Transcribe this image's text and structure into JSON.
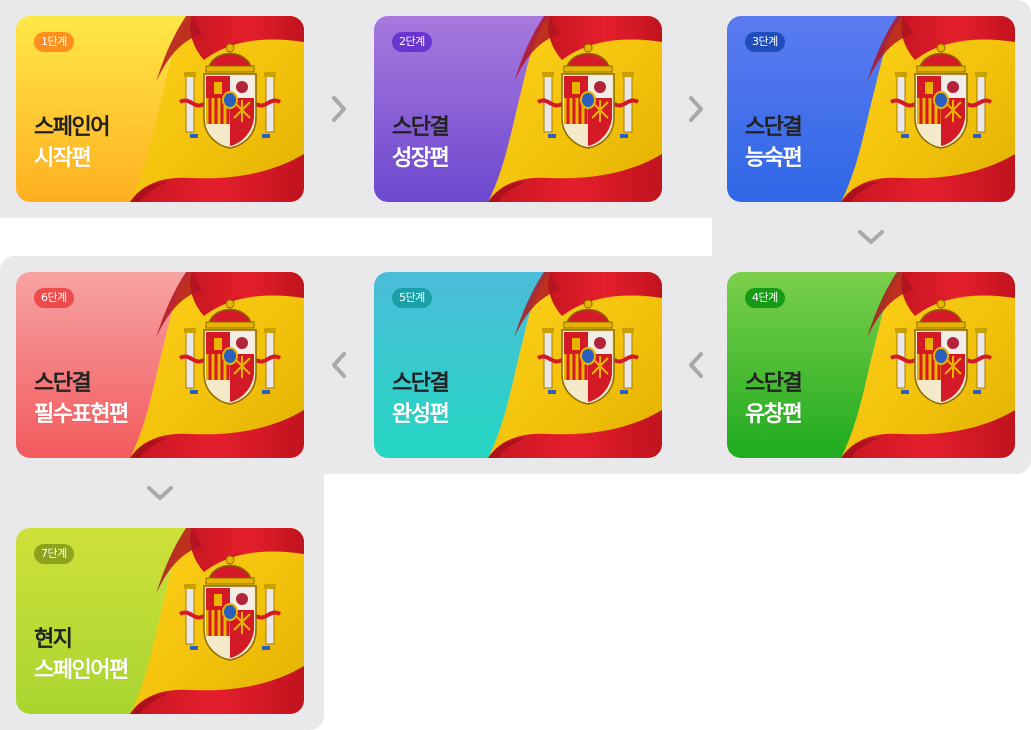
{
  "stages": [
    {
      "badge": "1단계",
      "line1": "스페인어",
      "line2": "시작편",
      "color_top": "#ffe748",
      "color_bottom": "#ffb020",
      "badge_color": "#ff8f1f"
    },
    {
      "badge": "2단계",
      "line1": "스단결",
      "line2": "성장편",
      "color_top": "#a879dd",
      "color_bottom": "#6d48cf",
      "badge_color": "#6a35cf"
    },
    {
      "badge": "3단계",
      "line1": "스단결",
      "line2": "능숙편",
      "color_top": "#5b7bf0",
      "color_bottom": "#2f67e6",
      "badge_color": "#1f4dbb"
    },
    {
      "badge": "4단계",
      "line1": "스단결",
      "line2": "유창편",
      "color_top": "#7cd04c",
      "color_bottom": "#1fab1f",
      "badge_color": "#159b15"
    },
    {
      "badge": "5단계",
      "line1": "스단결",
      "line2": "완성편",
      "color_top": "#4bbcd9",
      "color_bottom": "#24d6c2",
      "badge_color": "#1b9fa9"
    },
    {
      "badge": "6단계",
      "line1": "스단결",
      "line2": "필수표현편",
      "color_top": "#f8a3a3",
      "color_bottom": "#f25a5d",
      "badge_color": "#ee4c4c"
    },
    {
      "badge": "7단계",
      "line1": "현지",
      "line2": "스페인어편",
      "color_top": "#cfe03a",
      "color_bottom": "#a9d531",
      "badge_color": "#8fa21c"
    }
  ],
  "icons": {
    "next_right": "chevron-right-icon",
    "next_down": "chevron-down-icon",
    "next_left": "chevron-left-icon"
  }
}
